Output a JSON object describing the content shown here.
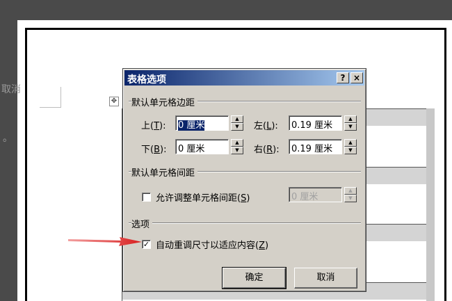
{
  "background_text": {
    "line1": "取消",
    "line2": "。"
  },
  "dialog": {
    "title": "表格选项",
    "help_button": "?",
    "close_button": "×",
    "margins": {
      "group_label": "默认单元格边距",
      "top": {
        "label_pre": "上(",
        "key": "T",
        "label_post": "):",
        "value": "0 厘米"
      },
      "bottom": {
        "label_pre": "下(",
        "key": "B",
        "label_post": "):",
        "value": "0 厘米"
      },
      "left": {
        "label_pre": "左(",
        "key": "L",
        "label_post": "):",
        "value": "0.19 厘米"
      },
      "right": {
        "label_pre": "右(",
        "key": "R",
        "label_post": "):",
        "value": "0.19 厘米"
      }
    },
    "spacing": {
      "group_label": "默认单元格间距",
      "allow_label_pre": "允许调整单元格间距(",
      "allow_key": "S",
      "allow_label_post": ")",
      "value": "0 厘米",
      "checked": false
    },
    "options": {
      "group_label": "选项",
      "autofit_label_pre": "自动重调尺寸以适应内容(",
      "autofit_key": "Z",
      "autofit_label_post": ")",
      "checked": true
    },
    "ok_label": "确定",
    "cancel_label": "取消"
  },
  "colors": {
    "titlebar": "#0a246a",
    "dialog_bg": "#d4d0c8",
    "arrow": "#d81e1e"
  }
}
